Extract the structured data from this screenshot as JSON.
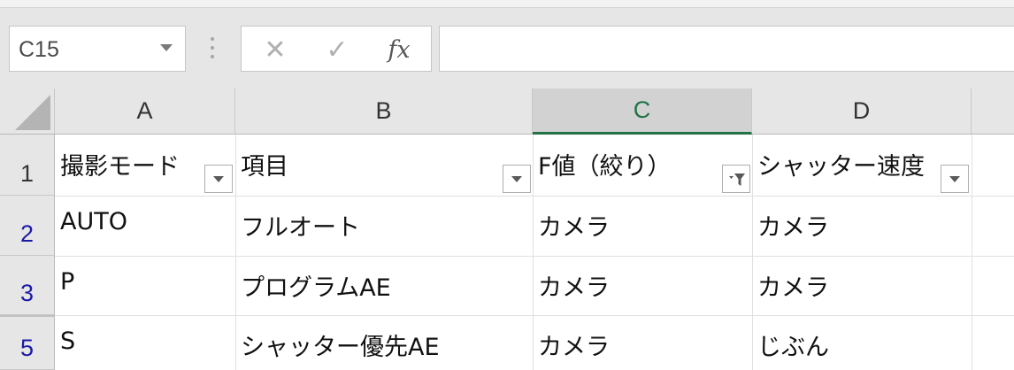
{
  "name_box": {
    "value": "C15"
  },
  "formula_buttons": {
    "cancel": "✕",
    "enter": "✓",
    "function": "fx"
  },
  "formula_bar": {
    "value": ""
  },
  "columns": [
    "A",
    "B",
    "C",
    "D"
  ],
  "selected_column": "C",
  "rows": [
    {
      "number": "1",
      "cells": [
        "撮影モード",
        "項目",
        "F値（絞り）",
        "シャッター速度"
      ]
    },
    {
      "number": "2",
      "cells": [
        "AUTO",
        "フルオート",
        "カメラ",
        "カメラ"
      ]
    },
    {
      "number": "3",
      "cells": [
        "P",
        "プログラムAE",
        "カメラ",
        "カメラ"
      ]
    },
    {
      "number": "5",
      "cells": [
        "S",
        "シャッター優先AE",
        "カメラ",
        "じぶん"
      ]
    }
  ],
  "filters": {
    "A": "dropdown",
    "B": "dropdown",
    "C": "filtered",
    "D": "dropdown"
  },
  "colors": {
    "accent": "#217346",
    "filtered_row_number": "#1a1aa6"
  }
}
